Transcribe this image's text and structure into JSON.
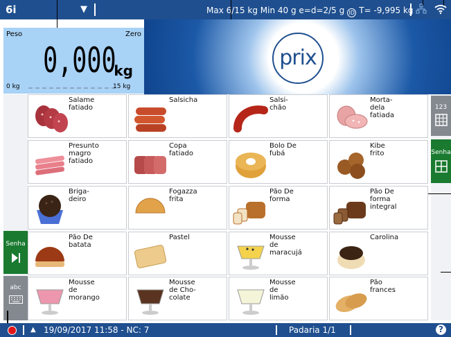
{
  "topbar": {
    "profile": "6i",
    "dropdown_icon": "▼",
    "specs": "Max 6/15 kg Min 40 g e=d=2/5 g",
    "mode_badge": "ID",
    "tare": "T= -9,995 kg",
    "network_icon": "network-icon",
    "wifi_icon": "wifi-icon"
  },
  "weight": {
    "label": "Peso",
    "zero_label": "Zero",
    "value": "0,000",
    "unit": "kg",
    "scale_min": "0 kg",
    "scale_max": "15 kg"
  },
  "brand": {
    "logo": "prix"
  },
  "left_panel": {
    "senha_label": "Senha",
    "abc_label": "abc"
  },
  "right_panel": {
    "numeric_label": "123",
    "senha_label": "Senha"
  },
  "products": [
    {
      "name": "Salame\nfatiado",
      "icon": "salami"
    },
    {
      "name": "Salsicha",
      "icon": "sausage"
    },
    {
      "name": "Salsi-\nchão",
      "icon": "big-sausage"
    },
    {
      "name": "Morta-\ndela\nfatiada",
      "icon": "mortadella"
    },
    {
      "name": "Presunto\nmagro\nfatiado",
      "icon": "ham"
    },
    {
      "name": "Copa\nfatiado",
      "icon": "copa"
    },
    {
      "name": "Bolo De\nfubá",
      "icon": "cake"
    },
    {
      "name": "Kibe\nfrito",
      "icon": "kibe"
    },
    {
      "name": "Briga-\ndeiro",
      "icon": "brigadeiro"
    },
    {
      "name": "Fogazza\nfrita",
      "icon": "fogazza"
    },
    {
      "name": "Pão De\nforma",
      "icon": "bread-loaf"
    },
    {
      "name": "Pão De\nforma\nintegral",
      "icon": "whole-bread"
    },
    {
      "name": "Pão De\nbatata",
      "icon": "potato-bread"
    },
    {
      "name": "Pastel",
      "icon": "pastel"
    },
    {
      "name": "Mousse\nde\nmaracujá",
      "icon": "mousse-yellow"
    },
    {
      "name": "Carolina",
      "icon": "carolina"
    },
    {
      "name": "Mousse\nde\nmorango",
      "icon": "mousse-pink"
    },
    {
      "name": "Mousse\nde Cho-\ncolate",
      "icon": "mousse-choc"
    },
    {
      "name": "Mousse\nde\nlimão",
      "icon": "mousse-white"
    },
    {
      "name": "Pão\nfrances",
      "icon": "french-bread"
    }
  ],
  "status": {
    "warning_icon": "▲",
    "datetime": "19/09/2017 11:58 - NC: 7",
    "department": "Padaria 1/1",
    "help": "?"
  }
}
